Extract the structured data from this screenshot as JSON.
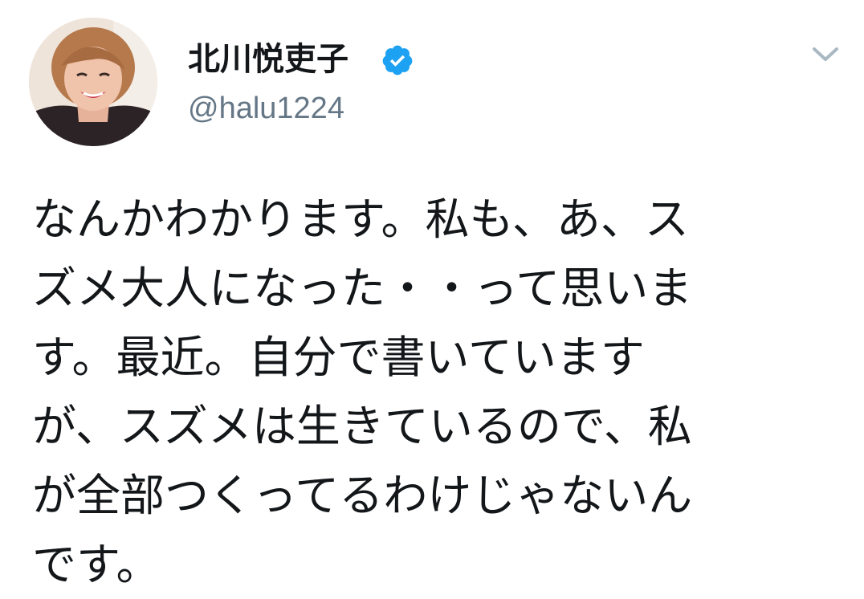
{
  "tweet": {
    "author": {
      "display_name": "北川悦吏子",
      "handle": "@halu1224",
      "verified": true,
      "avatar": "profile-photo-smiling-woman"
    },
    "text": "なんかわかります。私も、あ、ス\nズメ大人になった・・って思いま\nす。最近。自分で書いています\nが、スズメは生きているので、私\nが全部つくってるわけじゃないん\nです。"
  },
  "colors": {
    "text": "#14171a",
    "secondary": "#657786",
    "verified_badge": "#1da1f2",
    "caret": "#aab8c2"
  },
  "icons": {
    "verified": "verified-badge-icon",
    "menu": "chevron-down-icon"
  }
}
